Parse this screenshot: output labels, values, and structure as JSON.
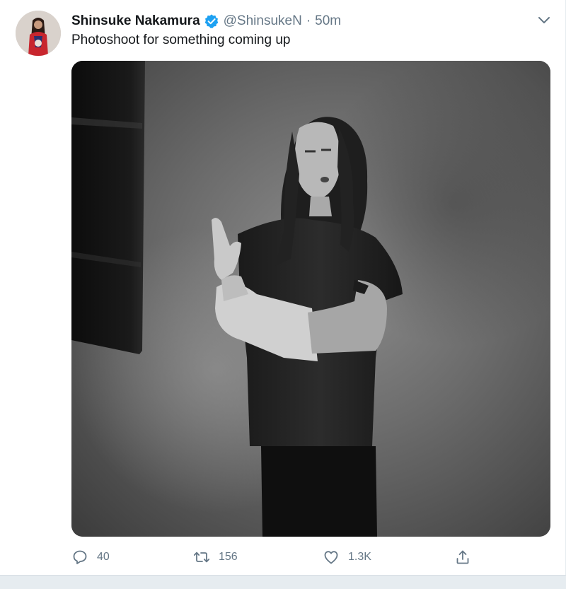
{
  "tweet": {
    "author": {
      "display_name": "Shinsuke Nakamura",
      "handle": "@ShinsukeN",
      "verified": true,
      "avatar_icon": "profile-photo"
    },
    "separator": "·",
    "time": "50m",
    "text": "Photoshoot for something coming up",
    "media": {
      "type": "black-and-white photo",
      "icon": "photo-image"
    },
    "actions": {
      "reply": {
        "icon": "reply-icon",
        "count": "40"
      },
      "retweet": {
        "icon": "retweet-icon",
        "count": "156"
      },
      "like": {
        "icon": "heart-icon",
        "count": "1.3K"
      },
      "share": {
        "icon": "share-icon"
      }
    },
    "menu_icon": "chevron-down-icon"
  },
  "colors": {
    "name": "#14171a",
    "secondary": "#657786",
    "verified": "#1da1f2",
    "divider": "#e6ecf0"
  }
}
